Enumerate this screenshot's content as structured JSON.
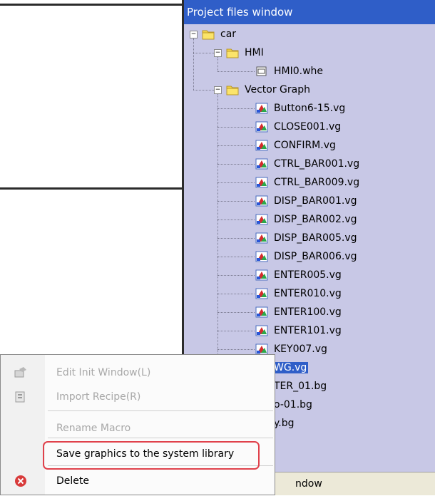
{
  "panel": {
    "title": "Project files window"
  },
  "tree": {
    "root": "car",
    "hmi_folder": "HMI",
    "hmi_file": "HMI0.whe",
    "vg_folder": "Vector Graph",
    "vg_files": [
      "Button6-15.vg",
      "CLOSE001.vg",
      "CONFIRM.vg",
      "CTRL_BAR001.vg",
      "CTRL_BAR009.vg",
      "DISP_BAR001.vg",
      "DISP_BAR002.vg",
      "DISP_BAR005.vg",
      "DISP_BAR006.vg",
      "ENTER005.vg",
      "ENTER010.vg",
      "ENTER100.vg",
      "ENTER101.vg",
      "KEY007.vg"
    ],
    "selected_partial": "WG.vg",
    "partial_items": [
      "TER_01.bg",
      "o-01.bg",
      "y.bg"
    ]
  },
  "statusbar": {
    "partial": "ndow"
  },
  "context_menu": {
    "items": [
      {
        "label": "Edit Init Window(L)",
        "enabled": false,
        "icon": "window-edit-icon"
      },
      {
        "label": "Import Recipe(R)",
        "enabled": false,
        "icon": "recipe-import-icon"
      },
      {
        "label": "Rename Macro",
        "enabled": false,
        "icon": ""
      },
      {
        "label": "Save graphics to the system library",
        "enabled": true,
        "icon": ""
      },
      {
        "label": "Delete",
        "enabled": true,
        "icon": "delete-icon"
      }
    ]
  },
  "colors": {
    "title_bar": "#2f5ec8",
    "panel_bg": "#c8c8e6",
    "highlight_box": "#e0414b"
  }
}
